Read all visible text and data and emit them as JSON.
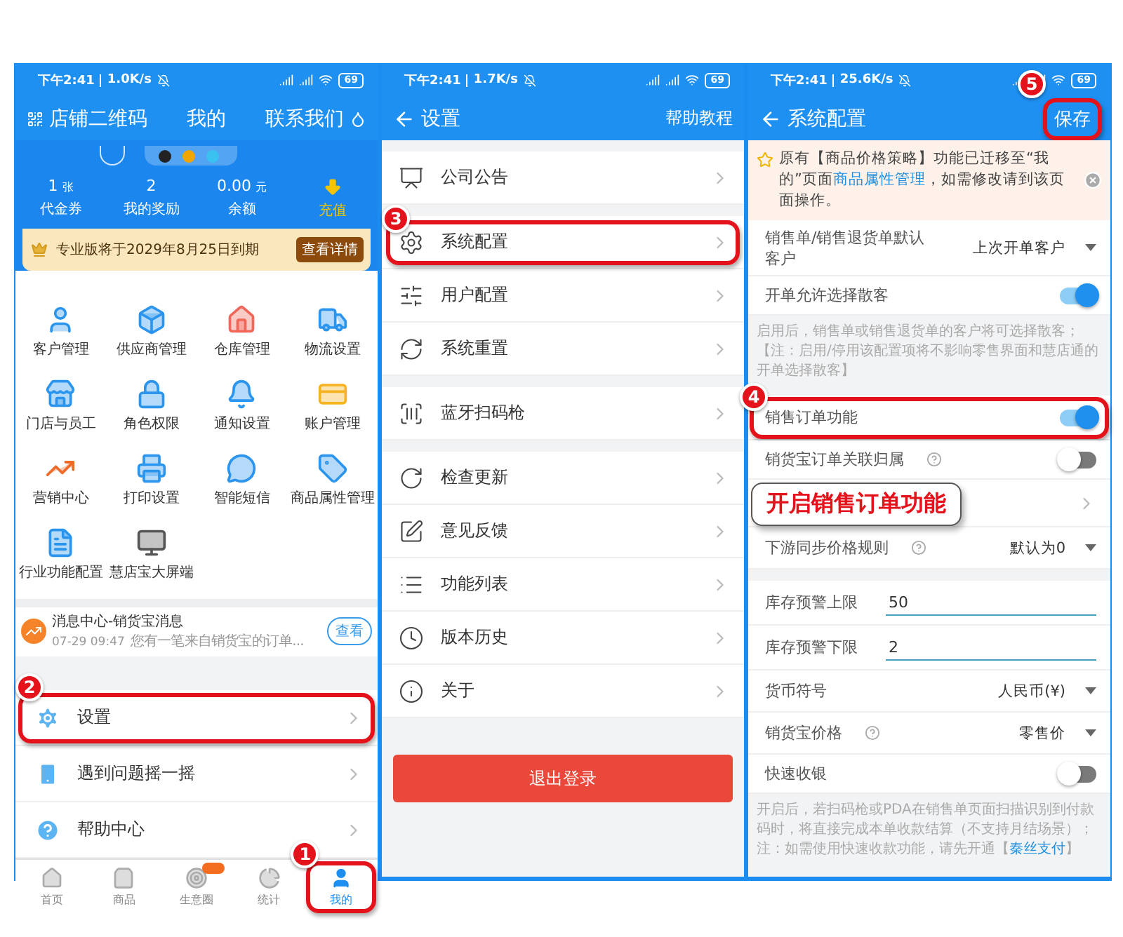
{
  "home": {
    "status": {
      "time": "下午2:41",
      "speed": "1.0K/s",
      "battery": "69"
    },
    "header": {
      "left": "店铺二维码",
      "title": "我的",
      "right": "联系我们"
    },
    "stats": [
      {
        "kind": "stat",
        "value": "1",
        "unit": "张",
        "label": "代金券"
      },
      {
        "kind": "stat",
        "value": "2",
        "label": "我的奖励"
      },
      {
        "kind": "stat",
        "value": "0.00",
        "unit": "元",
        "label": "余额"
      },
      {
        "kind": "action",
        "label": "充值"
      }
    ],
    "banner": {
      "text": "专业版将于2029年8月25日到期",
      "button": "查看详情"
    },
    "features": [
      {
        "label": "客户管理"
      },
      {
        "label": "供应商管理"
      },
      {
        "label": "仓库管理"
      },
      {
        "label": "物流设置"
      },
      {
        "label": "门店与员工"
      },
      {
        "label": "角色权限"
      },
      {
        "label": "通知设置"
      },
      {
        "label": "账户管理"
      },
      {
        "label": "营销中心"
      },
      {
        "label": "打印设置"
      },
      {
        "label": "智能短信"
      },
      {
        "label": "商品属性管理"
      },
      {
        "label": "行业功能配置"
      },
      {
        "label": "慧店宝大屏端"
      }
    ],
    "message": {
      "title": "消息中心-销货宝消息",
      "time": "07-29 09:47",
      "body": "您有一笔来自销货宝的订单...",
      "button": "查看"
    },
    "menu": [
      {
        "label": "设置",
        "step": "2"
      },
      {
        "label": "遇到问题摇一摇"
      },
      {
        "label": "帮助中心"
      }
    ],
    "tabs": [
      {
        "label": "首页",
        "selected": false
      },
      {
        "label": "商品",
        "selected": false
      },
      {
        "label": "生意圈",
        "selected": false,
        "badge": true
      },
      {
        "label": "统计",
        "selected": false
      },
      {
        "label": "我的",
        "selected": true,
        "step": "1"
      }
    ]
  },
  "settings": {
    "status": {
      "time": "下午2:41",
      "speed": "1.7K/s",
      "battery": "69"
    },
    "header": {
      "title": "设置",
      "right": "帮助教程"
    },
    "groups": [
      {
        "items": [
          {
            "label": "公司公告"
          }
        ]
      },
      {
        "items": [
          {
            "label": "系统配置",
            "step": "3"
          },
          {
            "label": "用户配置"
          },
          {
            "label": "系统重置"
          }
        ]
      },
      {
        "items": [
          {
            "label": "蓝牙扫码枪"
          }
        ]
      },
      {
        "items": [
          {
            "label": "检查更新"
          },
          {
            "label": "意见反馈"
          },
          {
            "label": "功能列表"
          },
          {
            "label": "版本历史"
          },
          {
            "label": "关于"
          }
        ]
      }
    ],
    "logout": "退出登录"
  },
  "config": {
    "status": {
      "time": "下午2:41",
      "speed": "25.6K/s",
      "battery": "69"
    },
    "header": {
      "title": "系统配置",
      "save": "保存",
      "save_step": "5"
    },
    "notice": {
      "before": "原有【商品价格策略】功能已迁移至“我的”页面",
      "link": "商品属性管理",
      "after": "，如需修改请到该页面操作。"
    },
    "rows": [
      {
        "kind": "select",
        "label": "销售单/销售退货单默认客户",
        "value": "上次开单客户"
      },
      {
        "kind": "toggle",
        "label": "开单允许选择散客",
        "on": true
      },
      {
        "kind": "note",
        "text": "启用后，销售单或销售退货单的客户将可选择散客；【注：启用/停用该配置项将不影响零售界面和慧店通的开单选择散客】"
      },
      {
        "kind": "toggle",
        "label": "销售订单功能",
        "on": true,
        "step": "4",
        "callout": "开启销售订单功能"
      },
      {
        "kind": "toggle",
        "label": "销货宝订单关联归属",
        "help": true,
        "on": false
      },
      {
        "kind": "link"
      },
      {
        "kind": "select",
        "label": "下游同步价格规则",
        "help": true,
        "value": "默认为0"
      },
      {
        "kind": "input",
        "label": "库存预警上限",
        "value": "50",
        "gap_before": true
      },
      {
        "kind": "input",
        "label": "库存预警下限",
        "value": "2"
      },
      {
        "kind": "select",
        "label": "货币符号",
        "value": "人民币(¥)"
      },
      {
        "kind": "select",
        "label": "销货宝价格",
        "help": true,
        "value": "零售价"
      },
      {
        "kind": "toggle",
        "label": "快速收银",
        "on": false
      },
      {
        "kind": "note",
        "text": "开启后，若扫码枪或PDA在销售单页面扫描识别到付款码时，将直接完成本单收款结算（不支持月结场景）；",
        "before": "注：如需使用快速收款功能，请先开通【",
        "link": "秦丝支付",
        "after": "】"
      }
    ]
  }
}
